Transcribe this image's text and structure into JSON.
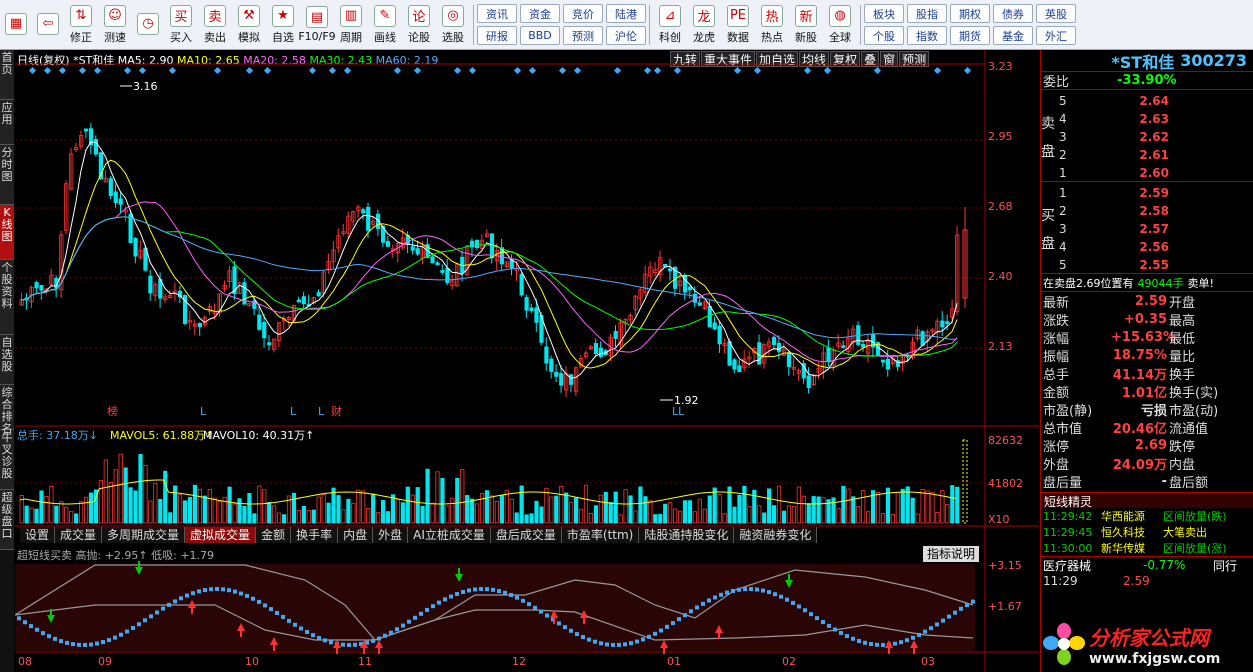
{
  "toolbar": {
    "buttons": [
      {
        "label": "",
        "icon": "grid-icon"
      },
      {
        "label": "",
        "icon": "back-arrow-icon"
      },
      {
        "label": "修正",
        "icon": "up-down-arrows-icon"
      },
      {
        "label": "测速",
        "icon": "face-icon"
      },
      {
        "label": "",
        "icon": "clock-icon"
      },
      {
        "label": "买入",
        "icon": "buy-icon"
      },
      {
        "label": "卖出",
        "icon": "sell-icon"
      },
      {
        "label": "模拟",
        "icon": "hammer-icon"
      },
      {
        "label": "自选",
        "icon": "star-icon"
      },
      {
        "label": "F10/F9",
        "icon": "f10-icon"
      },
      {
        "label": "周期",
        "icon": "period-icon"
      },
      {
        "label": "画线",
        "icon": "pencil-icon"
      },
      {
        "label": "论股",
        "icon": "discuss-icon"
      },
      {
        "label": "选股",
        "icon": "select-stock-icon"
      }
    ],
    "tags_a": [
      "资讯",
      "资金",
      "竞价",
      "陆港",
      "研报",
      "BBD",
      "预测",
      "沪伦"
    ],
    "buttons2": [
      {
        "label": "科创",
        "icon": "chart-up-icon"
      },
      {
        "label": "龙虎",
        "icon": "dragon-icon"
      },
      {
        "label": "数据",
        "icon": "pe-icon"
      },
      {
        "label": "热点",
        "icon": "hot-icon"
      },
      {
        "label": "新股",
        "icon": "new-stock-icon"
      },
      {
        "label": "全球",
        "icon": "globe-icon"
      }
    ],
    "tags_b": [
      "板块",
      "股指",
      "期权",
      "债券",
      "英股",
      "个股",
      "指数",
      "期货",
      "基金",
      "外汇"
    ]
  },
  "leftnav": [
    "首页",
    "应用",
    "分时图",
    "K线图",
    "个股资料",
    "自选股",
    "综合排名",
    "牛叉诊股",
    "超级盘口"
  ],
  "header": {
    "title": "日线(复权) *ST和佳",
    "ma5": "MA5: 2.90",
    "ma10": "MA10: 2.65",
    "ma20": "MA20: 2.58",
    "ma30": "MA30: 2.43",
    "ma60": "MA60: 2.19",
    "tools": [
      "九转",
      "重大事件",
      "加自选",
      "均线",
      "复权",
      "叠",
      "窗",
      "预测"
    ]
  },
  "price_axis": [
    "3.23",
    "2.95",
    "2.68",
    "2.40",
    "2.13"
  ],
  "annotations": {
    "high": "3.16",
    "low": "1.92"
  },
  "markers": [
    "榜",
    "L",
    "L",
    "L",
    "财",
    "LL"
  ],
  "volume": {
    "label": "总手: 37.18万↓",
    "mavol5": "MAVOL5: 61.88万↑",
    "mavol10": "MAVOL10: 40.31万↑",
    "axis": [
      "82632",
      "41802",
      "X10"
    ]
  },
  "tabs": [
    "设置",
    "成交量",
    "多周期成交量",
    "虚拟成交量",
    "金额",
    "换手率",
    "内盘",
    "外盘",
    "AI立桩成交量",
    "盘后成交量",
    "市盈率(ttm)",
    "陆股通持股变化",
    "融资融券变化"
  ],
  "selected_tab": "虚拟成交量",
  "indicator": {
    "label": "超短线买卖 高抛: +2.95↑ 低吸: +1.79",
    "help": "指标说明",
    "axis": [
      "+3.15",
      "+1.67"
    ]
  },
  "dates": [
    "08",
    "09",
    "10",
    "11",
    "12",
    "01",
    "02",
    "03"
  ],
  "quote": {
    "name": "*ST和佳",
    "code": "300273",
    "weibi_label": "委比",
    "weibi": "-33.90%",
    "sell_label": "卖盘",
    "buy_label": "买盘",
    "sell": [
      [
        "5",
        "2.64"
      ],
      [
        "4",
        "2.63"
      ],
      [
        "3",
        "2.62"
      ],
      [
        "2",
        "2.61"
      ],
      [
        "1",
        "2.60"
      ]
    ],
    "buy": [
      [
        "1",
        "2.59"
      ],
      [
        "2",
        "2.58"
      ],
      [
        "3",
        "2.57"
      ],
      [
        "4",
        "2.56"
      ],
      [
        "5",
        "2.55"
      ]
    ],
    "notice": "在卖盘2.69位置有",
    "notice_qty": "49044手",
    "notice_tail": "卖单!",
    "stats": [
      [
        "最新",
        "2.59",
        "开盘",
        ""
      ],
      [
        "涨跌",
        "+0.35",
        "最高",
        ""
      ],
      [
        "涨幅",
        "+15.63%",
        "最低",
        ""
      ],
      [
        "振幅",
        "18.75%",
        "量比",
        ""
      ],
      [
        "总手",
        "41.14万",
        "换手",
        ""
      ],
      [
        "金额",
        "1.01亿",
        "换手(实)",
        ""
      ],
      [
        "市盈(静)",
        "亏损",
        "市盈(动)",
        ""
      ],
      [
        "总市值",
        "20.46亿",
        "流通值",
        ""
      ],
      [
        "涨停",
        "2.69",
        "跌停",
        ""
      ],
      [
        "外盘",
        "24.09万",
        "内盘",
        ""
      ],
      [
        "盘后量",
        "-",
        "盘后额",
        ""
      ]
    ],
    "news_title": "短线精灵",
    "news": [
      [
        "11:29:42",
        "华西能源",
        "区间放量(跌)"
      ],
      [
        "11:29:45",
        "恒久科技",
        "大笔卖出"
      ],
      [
        "11:30:00",
        "新华传媒",
        "区间放量(涨)"
      ]
    ],
    "sector": "医疗器械",
    "sector_pct": "-0.77%",
    "sector_more": "同行",
    "tick_time": "11:29",
    "tick_price": "2.59",
    "logo": "分析家公式网",
    "logo_url": "www.fxjgsw.com"
  },
  "colors": {
    "up": "#ff3333",
    "down": "#00e5ee",
    "ma5": "#ffffff",
    "ma10": "#ffff00",
    "ma20": "#ff60ff",
    "ma30": "#00ff00",
    "ma60": "#4fa9ff"
  }
}
